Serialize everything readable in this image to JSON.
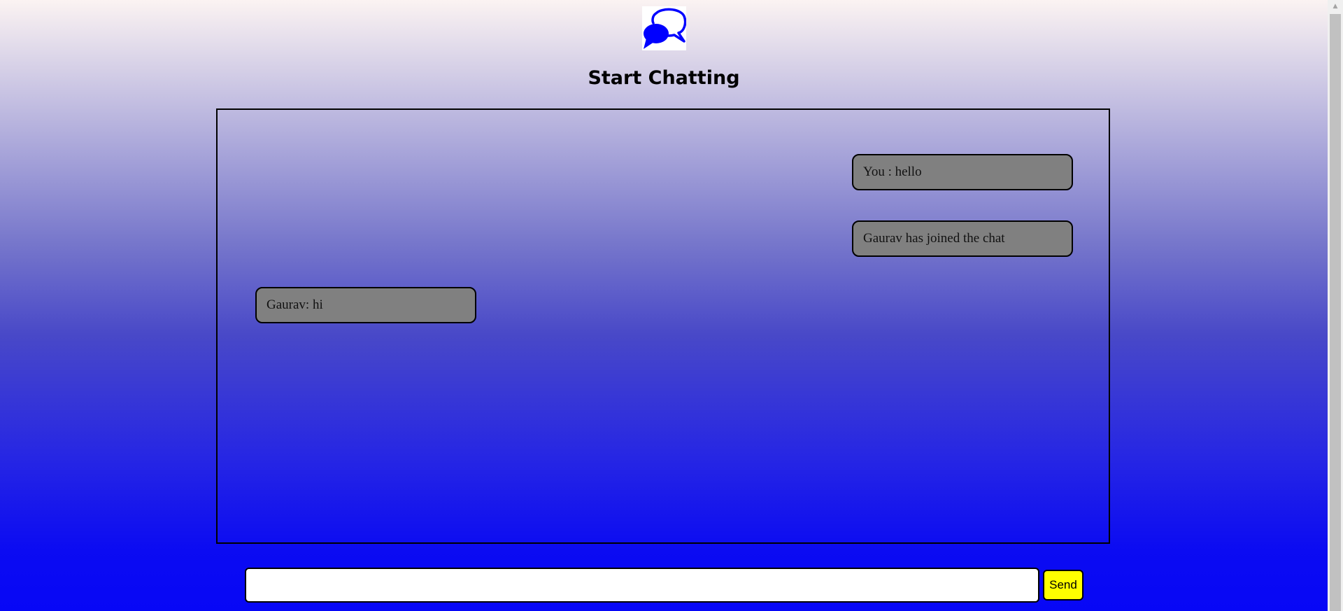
{
  "header": {
    "title": "Start Chatting",
    "logo_icon": "chat-bubbles-icon",
    "logo_color": "#0000ff"
  },
  "messages": [
    {
      "side": "right",
      "text": "You : hello"
    },
    {
      "side": "right",
      "text": "Gaurav has joined the chat"
    },
    {
      "side": "left",
      "text": "Gaurav: hi"
    }
  ],
  "composer": {
    "input_value": "",
    "send_label": "Send",
    "send_color": "#ffff00"
  }
}
